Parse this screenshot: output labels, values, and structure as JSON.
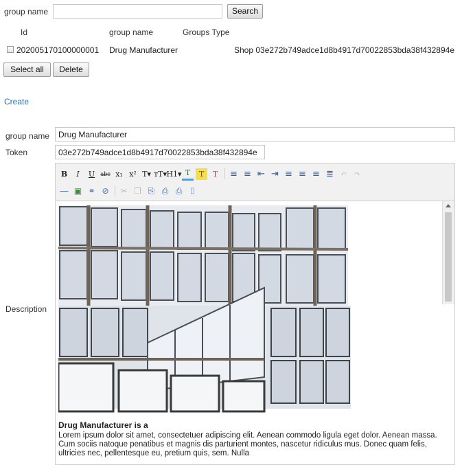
{
  "search": {
    "label": "group name",
    "value": "",
    "button": "Search"
  },
  "table": {
    "headers": [
      "Id",
      "group name",
      "Groups Type"
    ],
    "rows": [
      {
        "id": "202005170100000001",
        "group_name": "Drug Manufacturer",
        "groups_type": "Shop 03e272b749adce1d8b4917d70022853bda38f432894e"
      }
    ],
    "select_all": "Select all",
    "delete": "Delete"
  },
  "create_link": "Create",
  "form": {
    "group_name_label": "group name",
    "group_name_value": "Drug Manufacturer",
    "token_label": "Token",
    "token_value": "03e272b749adce1d8b4917d70022853bda38f432894e",
    "description_label": "Description"
  },
  "toolbar": {
    "row1": [
      {
        "name": "bold-icon",
        "glyph": "B"
      },
      {
        "name": "italic-icon",
        "glyph": "I"
      },
      {
        "name": "underline-icon",
        "glyph": "U"
      },
      {
        "name": "strikethrough-icon",
        "glyph": "abc"
      },
      {
        "name": "subscript-icon",
        "glyph": "x₁"
      },
      {
        "name": "superscript-icon",
        "glyph": "x²"
      },
      {
        "name": "font-icon",
        "glyph": "T▾"
      },
      {
        "name": "font-size-icon",
        "glyph": "тT▾"
      },
      {
        "name": "heading-icon",
        "glyph": "H1▾"
      },
      {
        "name": "text-color-icon",
        "glyph": "T"
      },
      {
        "name": "highlight-icon",
        "glyph": "T"
      },
      {
        "name": "clear-format-icon",
        "glyph": "T"
      },
      {
        "name": "sep",
        "glyph": ""
      },
      {
        "name": "bullet-list-icon",
        "glyph": "≡"
      },
      {
        "name": "numbered-list-icon",
        "glyph": "≡"
      },
      {
        "name": "outdent-icon",
        "glyph": "⇤"
      },
      {
        "name": "indent-icon",
        "glyph": "⇥"
      },
      {
        "name": "align-left-icon",
        "glyph": "≡"
      },
      {
        "name": "align-center-icon",
        "glyph": "≡"
      },
      {
        "name": "align-right-icon",
        "glyph": "≡"
      },
      {
        "name": "justify-icon",
        "glyph": "≣"
      },
      {
        "name": "undo-icon",
        "glyph": "↶"
      },
      {
        "name": "redo-icon",
        "glyph": "↷"
      }
    ],
    "row2": [
      {
        "name": "horizontal-rule-icon",
        "glyph": "―"
      },
      {
        "name": "image-icon",
        "glyph": "▣"
      },
      {
        "name": "link-icon",
        "glyph": "⚭"
      },
      {
        "name": "unlink-icon",
        "glyph": "⊘"
      },
      {
        "name": "sep",
        "glyph": ""
      },
      {
        "name": "cut-icon",
        "glyph": "✂"
      },
      {
        "name": "copy-icon",
        "glyph": "❐"
      },
      {
        "name": "paste-icon",
        "glyph": "⎘"
      },
      {
        "name": "paste-text-icon",
        "glyph": "⎙"
      },
      {
        "name": "print-icon",
        "glyph": "⎙"
      },
      {
        "name": "source-icon",
        "glyph": "⌷"
      }
    ]
  },
  "editor": {
    "heading": "Drug Manufacturer is a",
    "paragraph": "Lorem ipsum dolor sit amet, consectetuer adipiscing elit. Aenean commodo ligula eget dolor. Aenean massa. Cum sociis natoque penatibus et magnis dis parturient montes, nascetur ridiculus mus. Donec quam felis, ultricies nec, pellentesque eu, pretium quis, sem. Nulla"
  },
  "colors": {
    "link": "#2a6fb8",
    "border": "#c8c8c8",
    "toolbar_bg": "#f1f1f1"
  }
}
